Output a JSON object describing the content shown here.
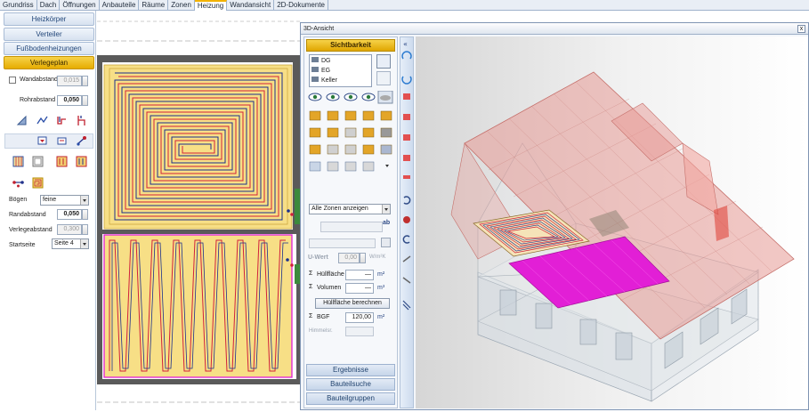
{
  "tabs": [
    "Grundriss",
    "Dach",
    "Öffnungen",
    "Anbauteile",
    "Räume",
    "Zonen",
    "Heizung",
    "Wandansicht",
    "2D-Dokumente"
  ],
  "active_tab": "Heizung",
  "left_panel": {
    "buttons": [
      "Heizkörper",
      "Verteiler",
      "Fußbodenheizungen",
      "Verlegeplan"
    ],
    "active_button": "Verlegeplan",
    "wandabstand_label": "Wandabstand",
    "wandabstand_value": "0,015",
    "rohrabstand_label": "Rohrabstand",
    "rohrabstand_value": "0,050",
    "boegen_label": "Bögen",
    "boegen_value": "feine",
    "randabstand_label": "Randabstand",
    "randabstand_value": "0,050",
    "verlegeabstand_label": "Verlegeabstand",
    "verlegeabstand_value": "0,300",
    "startseite_label": "Startseite",
    "startseite_value": "Seite 4"
  },
  "window3d": {
    "title": "3D-Ansicht",
    "close_label": "x",
    "sichtbarkeit_label": "Sichtbarkeit",
    "floors": [
      "DG",
      "EG",
      "Keller"
    ],
    "zones_select": "Alle Zonen anzeigen",
    "uwert_label": "U-Wert",
    "uwert_value": "0,00",
    "uwert_unit": "W/m²K",
    "huellflaeche_label": "Hüllfläche",
    "huellflaeche_value": "—",
    "huellflaeche_unit": "m²",
    "volumen_label": "Volumen",
    "volumen_value": "—",
    "volumen_unit": "m³",
    "calc_button": "Hüllfläche berechnen",
    "bgf_label": "BGF",
    "bgf_value": "120,00",
    "bgf_unit": "m²",
    "himmelsr_label": "Himmelsr.",
    "sum_symbol": "Σ",
    "ab_label": "ab",
    "bottom_buttons": [
      "Ergebnisse",
      "Bauteilsuche",
      "Bauteilgruppen"
    ]
  },
  "colors": {
    "accent": "#f2b200",
    "floor_heating_fill": "#f7df86",
    "pipe_red": "#d0213b",
    "pipe_blue": "#1c2f8c",
    "heating_magenta": "#e21fd6",
    "roof": "#e79a95"
  }
}
